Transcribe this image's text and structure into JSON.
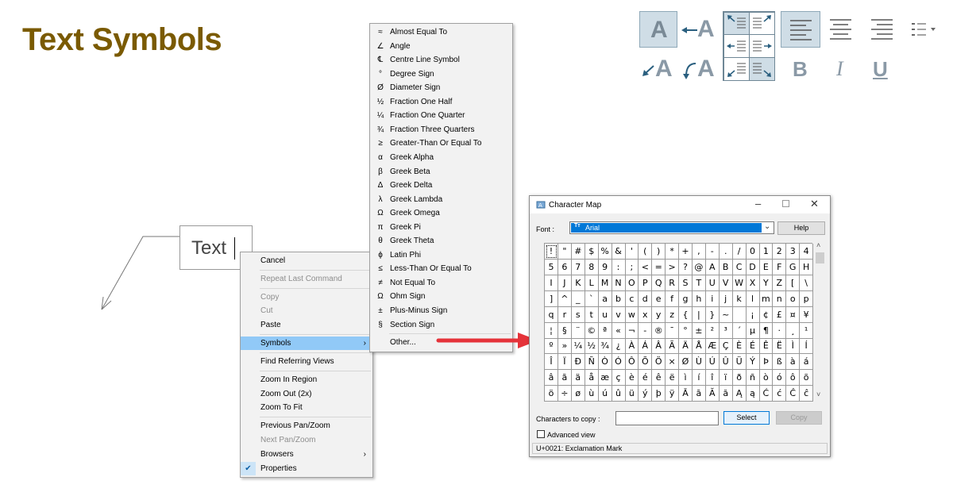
{
  "title": "Text Symbols",
  "toolbar": {
    "a_label": "A",
    "bold_label": "B",
    "italic_label": "I",
    "underline_label": "U"
  },
  "drawing": {
    "text_label": "Text"
  },
  "context_menu": {
    "items": [
      {
        "label": "Cancel",
        "disabled": false
      },
      {
        "label": "Repeat Last Command",
        "disabled": true
      },
      {
        "label": "Copy",
        "disabled": true
      },
      {
        "label": "Cut",
        "disabled": true
      },
      {
        "label": "Paste",
        "disabled": false
      },
      {
        "label": "Symbols",
        "disabled": false,
        "highlighted": true,
        "submenu": true
      },
      {
        "label": "Find Referring Views",
        "disabled": false
      },
      {
        "label": "Zoom In Region",
        "disabled": false
      },
      {
        "label": "Zoom Out (2x)",
        "disabled": false
      },
      {
        "label": "Zoom To Fit",
        "disabled": false
      },
      {
        "label": "Previous Pan/Zoom",
        "disabled": false
      },
      {
        "label": "Next Pan/Zoom",
        "disabled": true
      },
      {
        "label": "Browsers",
        "disabled": false,
        "submenu": true
      },
      {
        "label": "Properties",
        "disabled": false,
        "checked": true
      }
    ]
  },
  "symbols_menu": {
    "items": [
      {
        "symbol": "≈",
        "label": "Almost Equal To"
      },
      {
        "symbol": "∠",
        "label": "Angle"
      },
      {
        "symbol": "℄",
        "label": "Centre Line Symbol"
      },
      {
        "symbol": "°",
        "label": "Degree Sign"
      },
      {
        "symbol": "Ø",
        "label": "Diameter Sign"
      },
      {
        "symbol": "½",
        "label": "Fraction One Half"
      },
      {
        "symbol": "¼",
        "label": "Fraction One Quarter"
      },
      {
        "symbol": "¾",
        "label": "Fraction Three Quarters"
      },
      {
        "symbol": "≥",
        "label": "Greater-Than Or Equal To"
      },
      {
        "symbol": "α",
        "label": "Greek Alpha"
      },
      {
        "symbol": "β",
        "label": "Greek Beta"
      },
      {
        "symbol": "Δ",
        "label": "Greek Delta"
      },
      {
        "symbol": "λ",
        "label": "Greek Lambda"
      },
      {
        "symbol": "Ω",
        "label": "Greek Omega"
      },
      {
        "symbol": "π",
        "label": "Greek Pi"
      },
      {
        "symbol": "θ",
        "label": "Greek Theta"
      },
      {
        "symbol": "ϕ",
        "label": "Latin Phi"
      },
      {
        "symbol": "≤",
        "label": "Less-Than Or Equal To"
      },
      {
        "symbol": "≠",
        "label": "Not Equal To"
      },
      {
        "symbol": "Ω",
        "label": "Ohm Sign"
      },
      {
        "symbol": "±",
        "label": "Plus-Minus Sign"
      },
      {
        "symbol": "§",
        "label": "Section Sign"
      }
    ],
    "other_label": "Other..."
  },
  "charmap": {
    "title": "Character Map",
    "font_label": "Font :",
    "font_value": "Arial",
    "help_label": "Help",
    "chars_to_copy_label": "Characters to copy :",
    "chars_to_copy_value": "",
    "select_label": "Select",
    "copy_label": "Copy",
    "advanced_view_label": "Advanced view",
    "status": "U+0021: Exclamation Mark",
    "grid": [
      [
        "!",
        "\"",
        "#",
        "$",
        "%",
        "&",
        "'",
        "(",
        ")",
        "*",
        "+",
        ",",
        "-",
        ".",
        "/",
        "0",
        "1",
        "2",
        "3",
        "4"
      ],
      [
        "5",
        "6",
        "7",
        "8",
        "9",
        ":",
        ";",
        "<",
        "=",
        ">",
        "?",
        "@",
        "A",
        "B",
        "C",
        "D",
        "E",
        "F",
        "G",
        "H"
      ],
      [
        "I",
        "J",
        "K",
        "L",
        "M",
        "N",
        "O",
        "P",
        "Q",
        "R",
        "S",
        "T",
        "U",
        "V",
        "W",
        "X",
        "Y",
        "Z",
        "[",
        "\\"
      ],
      [
        "]",
        "^",
        "_",
        "`",
        "a",
        "b",
        "c",
        "d",
        "e",
        "f",
        "g",
        "h",
        "i",
        "j",
        "k",
        "l",
        "m",
        "n",
        "o",
        "p"
      ],
      [
        "q",
        "r",
        "s",
        "t",
        "u",
        "v",
        "w",
        "x",
        "y",
        "z",
        "{",
        "|",
        "}",
        "~",
        " ",
        "¡",
        "¢",
        "£",
        "¤",
        "¥"
      ],
      [
        "¦",
        "§",
        "¨",
        "©",
        "ª",
        "«",
        "¬",
        "-",
        "®",
        "¯",
        "°",
        "±",
        "²",
        "³",
        "´",
        "µ",
        "¶",
        "·",
        "¸",
        "¹"
      ],
      [
        "º",
        "»",
        "¼",
        "½",
        "¾",
        "¿",
        "À",
        "Á",
        "Â",
        "Ã",
        "Ä",
        "Å",
        "Æ",
        "Ç",
        "È",
        "É",
        "Ê",
        "Ë",
        "Ì",
        "Í"
      ],
      [
        "Î",
        "Ï",
        "Ð",
        "Ñ",
        "Ò",
        "Ó",
        "Ô",
        "Õ",
        "Ö",
        "×",
        "Ø",
        "Ù",
        "Ú",
        "Û",
        "Ü",
        "Ý",
        "Þ",
        "ß",
        "à",
        "á"
      ],
      [
        "â",
        "ã",
        "ä",
        "å",
        "æ",
        "ç",
        "è",
        "é",
        "ê",
        "ë",
        "ì",
        "í",
        "î",
        "ï",
        "ð",
        "ñ",
        "ò",
        "ó",
        "ô",
        "õ"
      ],
      [
        "ö",
        "÷",
        "ø",
        "ù",
        "ú",
        "û",
        "ü",
        "ý",
        "þ",
        "ÿ",
        "Ā",
        "ā",
        "Ă",
        "ă",
        "Ą",
        "ą",
        "Ć",
        "ć",
        "Ĉ",
        "ĉ"
      ]
    ]
  },
  "colors": {
    "title": "#7a5a00",
    "menu_highlight": "#91c9f7",
    "arrow": "#e5333a",
    "font_select": "#0078d7"
  }
}
